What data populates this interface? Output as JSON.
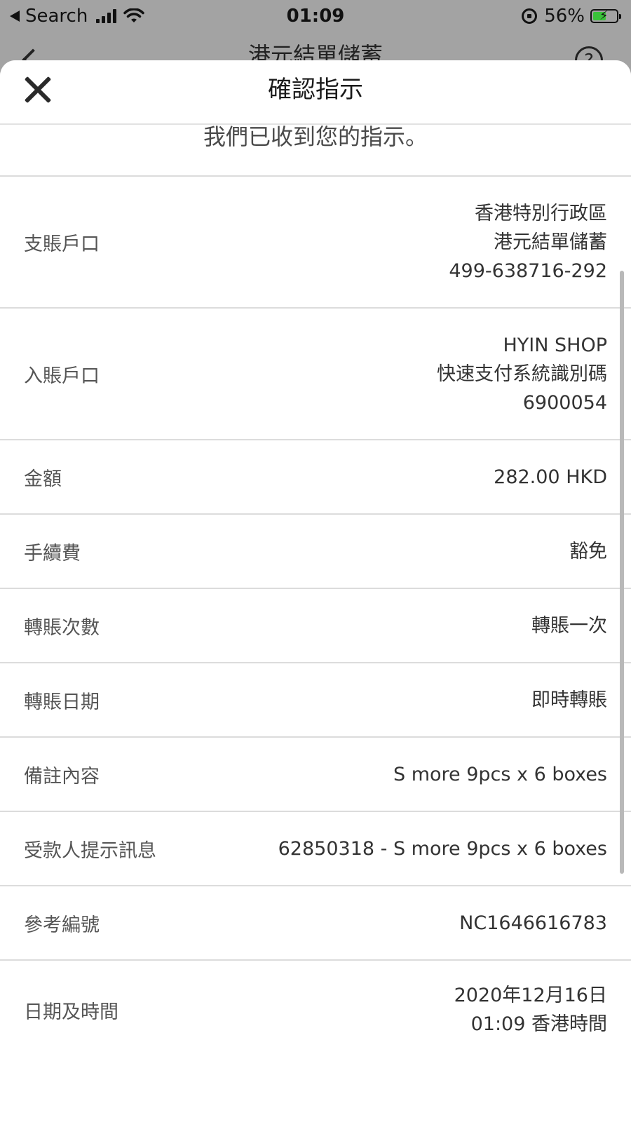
{
  "status_bar": {
    "back_app": "Search",
    "time": "01:09",
    "battery_percent": "56%",
    "battery_level": 0.56,
    "battery_color": "#3ac23a"
  },
  "background_nav": {
    "title": "港元結單儲蓄",
    "help_glyph": "?"
  },
  "sheet": {
    "title": "確認指示",
    "received_message": "我們已收到您的指示。",
    "rows": [
      {
        "label": "支賬戶口",
        "values": [
          "香港特別行政區",
          "港元結單儲蓄",
          "499-638716-292"
        ]
      },
      {
        "label": "入賬戶口",
        "values": [
          "HYIN SHOP",
          "快速支付系統識別碼",
          "6900054"
        ]
      },
      {
        "label": "金額",
        "values": [
          "282.00 HKD"
        ]
      },
      {
        "label": "手續費",
        "values": [
          "豁免"
        ]
      },
      {
        "label": "轉賬次數",
        "values": [
          "轉賬一次"
        ]
      },
      {
        "label": "轉賬日期",
        "values": [
          "即時轉賬"
        ]
      },
      {
        "label": "備註內容",
        "values": [
          "S more 9pcs x 6 boxes"
        ]
      },
      {
        "label": "受款人提示訊息",
        "values": [
          "62850318 - S more 9pcs x 6 boxes"
        ]
      },
      {
        "label": "參考編號",
        "values": [
          "NC1646616783"
        ]
      },
      {
        "label": "日期及時間",
        "values": [
          "2020年12月16日",
          "01:09 香港時間"
        ]
      }
    ]
  }
}
